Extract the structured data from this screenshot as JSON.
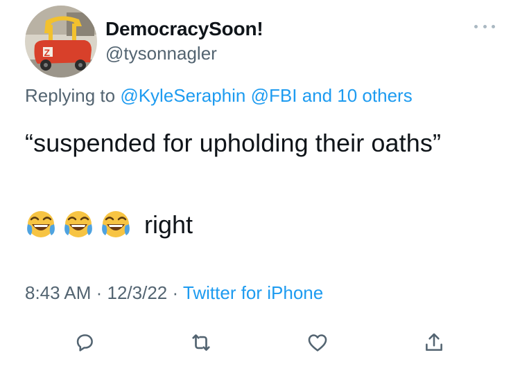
{
  "author": {
    "display_name": "DemocracySoon!",
    "handle": "@tysonnagler",
    "avatar_icon": "avatar-ride-on-car-image"
  },
  "reply": {
    "prefix": "Replying to ",
    "mention1": "@KyleSeraphin",
    "mention2": "@FBI",
    "others": "and 10 others"
  },
  "tweet": {
    "line1": "“suspended for upholding their oaths”",
    "emoji_name": "face-with-tears-of-joy",
    "emoji_count": 3,
    "line2_word": "right"
  },
  "meta": {
    "time": "8:43 AM",
    "separator": " · ",
    "date": "12/3/22",
    "source": "Twitter for iPhone"
  },
  "actions": {
    "icons": [
      "reply-icon",
      "retweet-icon",
      "like-icon",
      "share-icon"
    ]
  },
  "colors": {
    "link": "#1d9bf0",
    "secondary_text": "#536471",
    "icon": "#536471"
  }
}
